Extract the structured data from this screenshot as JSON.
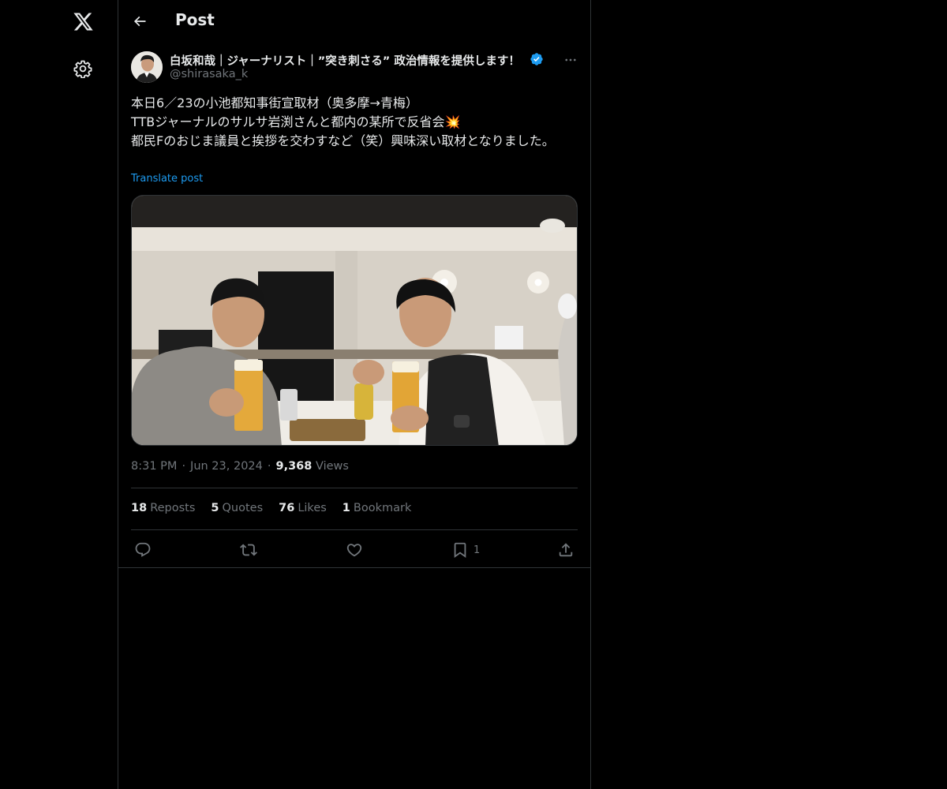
{
  "header": {
    "title": "Post"
  },
  "author": {
    "display_name": "白坂和哉｜ジャーナリスト｜”突き刺さる” 政治情報を提供します！",
    "handle": "@shirasaka_k"
  },
  "post": {
    "text": "本日6／23の小池都知事街宣取材（奥多摩→青梅）\nTTBジャーナルのサルサ岩渕さんと都内の某所で反省会💥\n都民Fのおじま議員と挨拶を交わすなど（笑）興味深い取材となりました。",
    "translate_label": "Translate post",
    "time": "8:31 PM",
    "date": "Jun 23, 2024",
    "views_count": "9,368",
    "views_label": "Views"
  },
  "stats": {
    "reposts_count": "18",
    "reposts_label": "Reposts",
    "quotes_count": "5",
    "quotes_label": "Quotes",
    "likes_count": "76",
    "likes_label": "Likes",
    "bookmarks_count": "1",
    "bookmarks_label": "Bookmark"
  },
  "actions": {
    "bookmark_count": "1"
  },
  "icons": [
    "x-logo-icon",
    "gear-icon",
    "back-arrow-icon",
    "verified-badge-icon",
    "more-icon",
    "reply-icon",
    "repost-icon",
    "like-icon",
    "bookmark-icon",
    "share-icon"
  ],
  "colors": {
    "background": "#000000",
    "text": "#e7e9ea",
    "muted": "#71767b",
    "accent": "#1d9bf0",
    "border": "#2f3336"
  }
}
